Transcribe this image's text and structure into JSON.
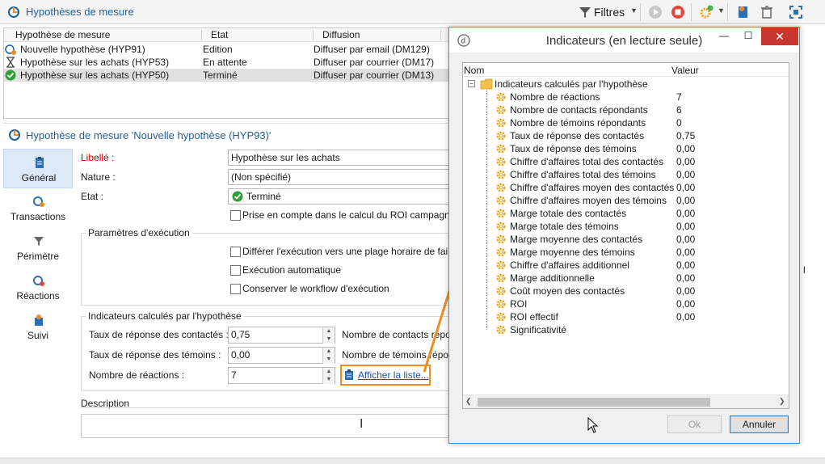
{
  "app": {
    "title": "Hypothèses de mesure",
    "filters_label": "Filtres"
  },
  "list": {
    "columns": [
      "Hypothèse de mesure",
      "Etat",
      "Diffusion"
    ],
    "rows": [
      {
        "name": "Nouvelle hypothèse (HYP91)",
        "state": "Edition",
        "delivery": "Diffuser par email (DM129)",
        "status_icon": "new-hypothesis-icon",
        "selected": false
      },
      {
        "name": "Hypothèse sur les achats (HYP53)",
        "state": "En attente",
        "delivery": "Diffuser par courrier (DM17)",
        "status_icon": "hourglass-icon",
        "selected": false
      },
      {
        "name": "Hypothèse sur les achats (HYP50)",
        "state": "Terminé",
        "delivery": "Diffuser par courrier (DM13)",
        "status_icon": "check-circle-icon",
        "selected": true
      }
    ]
  },
  "detail": {
    "title": "Hypothèse de mesure 'Nouvelle hypothèse (HYP93)'",
    "nav": [
      {
        "label": "Général",
        "icon": "clipboard-icon",
        "active": true
      },
      {
        "label": "Transactions",
        "icon": "transactions-icon",
        "active": false
      },
      {
        "label": "Périmètre",
        "icon": "funnel-icon",
        "active": false
      },
      {
        "label": "Réactions",
        "icon": "reactions-icon",
        "active": false
      },
      {
        "label": "Suivi",
        "icon": "tracking-icon",
        "active": false
      }
    ],
    "fields": {
      "label_label": "Libellé :",
      "label_value": "Hypothèse sur les achats",
      "nature_label": "Nature :",
      "nature_value": "(Non spécifié)",
      "state_label": "Etat :",
      "state_value": "Terminé",
      "roi_checkbox": "Prise en compte dans le calcul du ROI campagne"
    },
    "execution": {
      "title": "Paramètres d'exécution",
      "defer": "Différer l'exécution vers une plage horaire de faib",
      "auto": "Exécution automatique",
      "keep_workflow": "Conserver le workflow d'exécution"
    },
    "indicators": {
      "title": "Indicateurs calculés par l'hypothèse",
      "contacts_rate_label": "Taux de réponse des contactés :",
      "contacts_rate_value": "0,75",
      "witness_rate_label": "Taux de réponse des témoins :",
      "witness_rate_value": "0,00",
      "reactions_label": "Nombre de réactions :",
      "reactions_value": "7",
      "contacts_resp_label": "Nombre de contacts répo",
      "witness_resp_label": "Nombre de témoins répo",
      "show_list_link": "Afficher la liste..."
    },
    "description_label": "Description"
  },
  "dialog": {
    "title": "Indicateurs (en lecture seule)",
    "col_name": "Nom",
    "col_value": "Valeur",
    "root": "Indicateurs calculés par l'hypothèse",
    "items": [
      {
        "name": "Nombre de réactions",
        "value": "7"
      },
      {
        "name": "Nombre de contacts répondants",
        "value": "6"
      },
      {
        "name": "Nombre de témoins répondants",
        "value": "0"
      },
      {
        "name": "Taux de réponse des contactés",
        "value": "0,75"
      },
      {
        "name": "Taux de réponse des témoins",
        "value": "0,00"
      },
      {
        "name": "Chiffre d'affaires total des contactés",
        "value": "0,00"
      },
      {
        "name": "Chiffre d'affaires total des témoins",
        "value": "0,00"
      },
      {
        "name": "Chiffre d'affaires moyen des contactés",
        "value": "0,00"
      },
      {
        "name": "Chiffre d'affaires moyen des témoins",
        "value": "0,00"
      },
      {
        "name": "Marge totale des contactés",
        "value": "0,00"
      },
      {
        "name": "Marge totale des témoins",
        "value": "0,00"
      },
      {
        "name": "Marge moyenne des contactés",
        "value": "0,00"
      },
      {
        "name": "Marge moyenne des témoins",
        "value": "0,00"
      },
      {
        "name": "Chiffre d'affaires additionnel",
        "value": "0,00"
      },
      {
        "name": "Marge additionnelle",
        "value": "0,00"
      },
      {
        "name": "Coût moyen des contactés",
        "value": "0,00"
      },
      {
        "name": "ROI",
        "value": "0,00"
      },
      {
        "name": "ROI effectif",
        "value": "0,00"
      },
      {
        "name": "Significativité",
        "value": ""
      }
    ],
    "ok_label": "Ok",
    "cancel_label": "Annuler",
    "close_glyph": "✕",
    "min_glyph": "—",
    "max_glyph": "☐"
  },
  "colors": {
    "accent": "#1f5f9e",
    "highlight": "#f08c1f",
    "required": "#c40000",
    "close": "#c7372f"
  }
}
